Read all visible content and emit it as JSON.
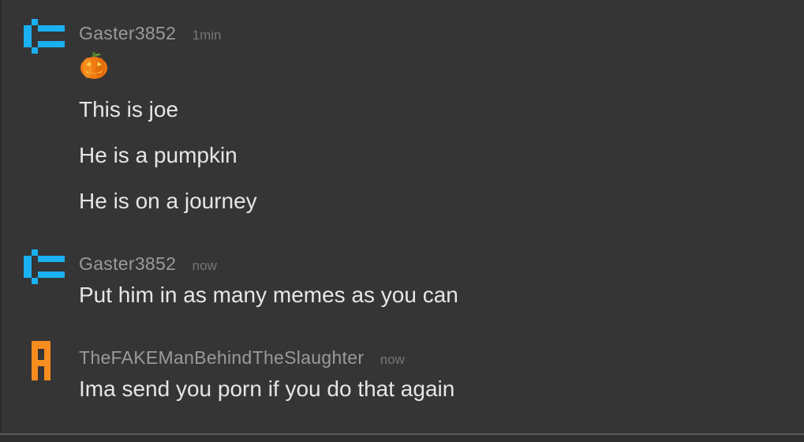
{
  "messages": [
    {
      "username": "Gaster3852",
      "time": "1min",
      "avatar_icon": "blue-pixel-glyph-icon",
      "emoji": "pumpkin-icon",
      "lines": [
        "This is joe",
        "He is a pumpkin",
        "He is on a journey"
      ]
    },
    {
      "username": "Gaster3852",
      "time": "now",
      "avatar_icon": "blue-pixel-glyph-icon",
      "lines": [
        "Put him in as many memes as you can"
      ]
    },
    {
      "username": "TheFAKEManBehindTheSlaughter",
      "time": "now",
      "avatar_icon": "orange-pixel-glyph-icon",
      "lines": [
        "Ima send you porn if you do that again"
      ]
    }
  ],
  "colors": {
    "background": "#353535",
    "username": "#9a9a9a",
    "timestamp": "#767676",
    "message_text": "#e6e6e6",
    "avatar_blue": "#1ab0f2",
    "avatar_orange": "#f78d1f"
  }
}
